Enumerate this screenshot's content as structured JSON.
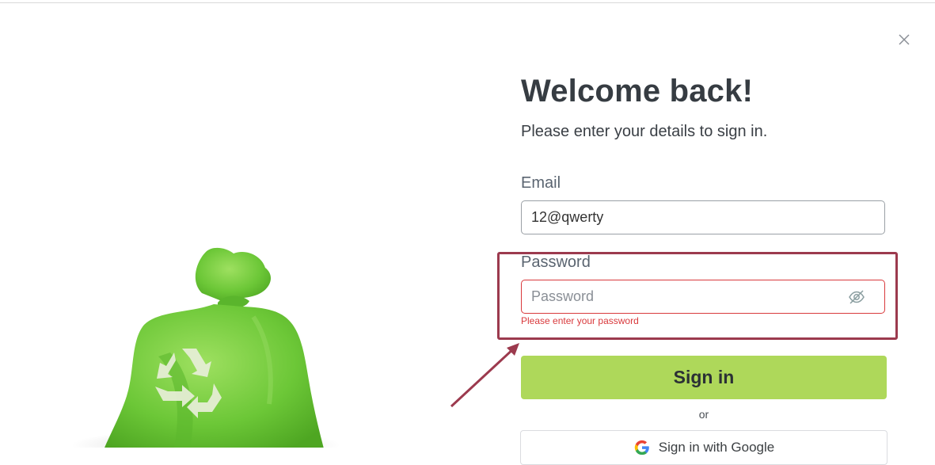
{
  "modal": {
    "title": "Welcome back!",
    "subtitle": "Please enter your details to sign in.",
    "close_icon": "close-icon"
  },
  "form": {
    "email": {
      "label": "Email",
      "value": "12@qwerty"
    },
    "password": {
      "label": "Password",
      "placeholder": "Password",
      "value": "",
      "error": "Please enter your password",
      "toggle_icon": "eye-off-icon"
    },
    "sign_in_label": "Sign in",
    "or_label": "or",
    "google_label": "Sign in with Google"
  },
  "illustration": {
    "name": "recycling-bag-image",
    "recycle_icon": "recycle-icon"
  },
  "annotation": {
    "highlight_color": "#9c3a4e"
  },
  "colors": {
    "accent": "#aed85a",
    "error": "#d9393c",
    "heading": "#363c42"
  }
}
